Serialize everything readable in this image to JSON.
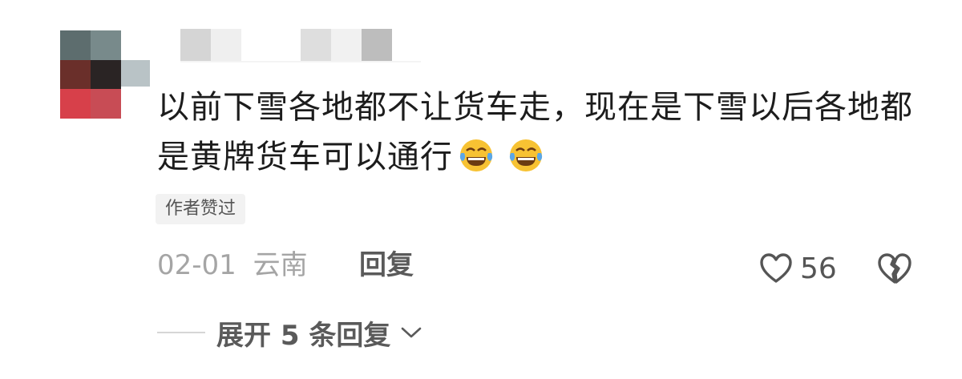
{
  "comment": {
    "text": "以前下雪各地都不让货车走，现在是下雪以后各地都是黄牌货车可以通行",
    "emojis": [
      "tears-of-joy-emoji",
      "tears-of-joy-emoji"
    ]
  },
  "badge": {
    "label": "作者赞过"
  },
  "meta": {
    "date": "02-01",
    "location": "云南",
    "reply_label": "回复"
  },
  "actions": {
    "like_count": "56",
    "like_icon": "heart-outline-icon",
    "dislike_icon": "broken-heart-icon"
  },
  "replies": {
    "expand_label": "展开 5 条回复",
    "expand_icon": "chevron-down-icon"
  }
}
